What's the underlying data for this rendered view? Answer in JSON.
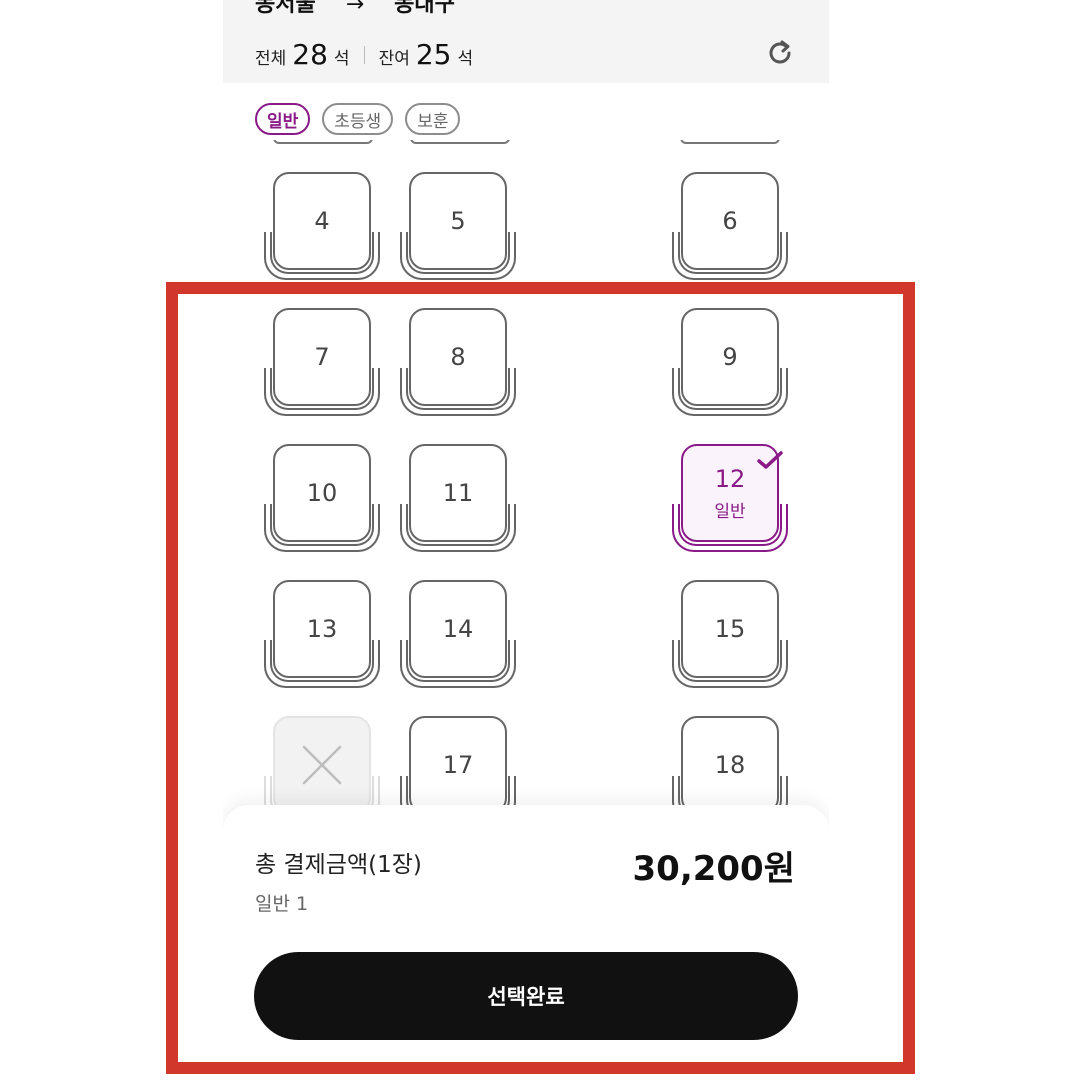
{
  "header": {
    "route_from": "동서울",
    "route_arrow": "→",
    "route_to": "동대구",
    "total_label": "전체",
    "total_count": "28",
    "remaining_label": "잔여",
    "remaining_count": "25",
    "seat_unit": "석"
  },
  "filters": [
    {
      "label": "일반",
      "active": true
    },
    {
      "label": "초등생",
      "active": false
    },
    {
      "label": "보훈",
      "active": false
    }
  ],
  "seats": [
    {
      "number": "4",
      "state": "available"
    },
    {
      "number": "5",
      "state": "available"
    },
    {
      "number": "6",
      "state": "available"
    },
    {
      "number": "7",
      "state": "available"
    },
    {
      "number": "8",
      "state": "available"
    },
    {
      "number": "9",
      "state": "available"
    },
    {
      "number": "10",
      "state": "available"
    },
    {
      "number": "11",
      "state": "available"
    },
    {
      "number": "12",
      "state": "selected",
      "type_label": "일반"
    },
    {
      "number": "13",
      "state": "available"
    },
    {
      "number": "14",
      "state": "available"
    },
    {
      "number": "15",
      "state": "available"
    },
    {
      "number": "",
      "state": "disabled"
    },
    {
      "number": "17",
      "state": "available"
    },
    {
      "number": "18",
      "state": "available"
    }
  ],
  "summary": {
    "title": "총 결제금액(1장)",
    "breakdown": "일반 1",
    "amount": "30,200원",
    "confirm_label": "선택완료"
  },
  "colors": {
    "accent": "#8a1a88",
    "highlight": "#d2372c",
    "button": "#111111"
  },
  "icons": {
    "refresh": "refresh-icon",
    "selected": "check-icon",
    "disabled_seat": "x-icon"
  }
}
